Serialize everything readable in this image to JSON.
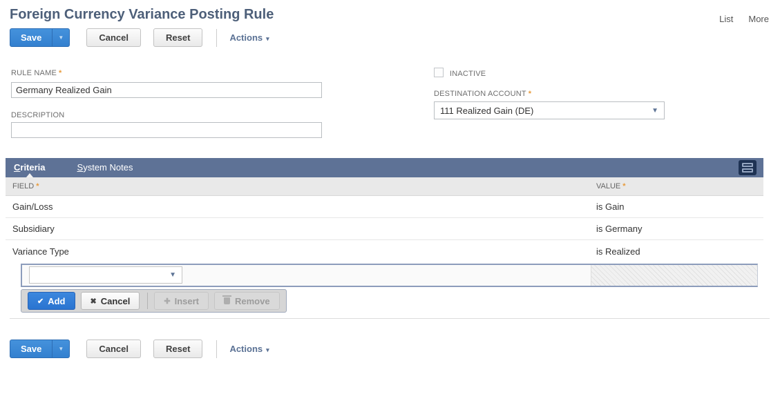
{
  "required_marker": "*",
  "icons": {
    "dropdown_arrow": "▼",
    "menu_arrow": "▾",
    "check": "✔",
    "x_mark": "✖",
    "plus": "✚"
  },
  "header": {
    "title": "Foreign Currency Variance Posting Rule",
    "links": {
      "list": "List",
      "more": "More"
    }
  },
  "toolbar": {
    "save": "Save",
    "cancel": "Cancel",
    "reset": "Reset",
    "actions": "Actions"
  },
  "form": {
    "rule_name": {
      "label": "RULE NAME",
      "value": "Germany Realized Gain"
    },
    "description": {
      "label": "DESCRIPTION",
      "value": ""
    },
    "inactive": {
      "label": "INACTIVE",
      "checked": false
    },
    "destination_account": {
      "label": "DESTINATION ACCOUNT",
      "value": "111 Realized Gain (DE)"
    }
  },
  "tabs": {
    "criteria": {
      "first": "C",
      "rest": "riteria"
    },
    "system_notes": {
      "first": "S",
      "rest": "ystem Notes"
    }
  },
  "criteria": {
    "columns": {
      "field": "FIELD",
      "value": "VALUE"
    },
    "rows": [
      {
        "field": "Gain/Loss",
        "value": "is Gain"
      },
      {
        "field": "Subsidiary",
        "value": "is Germany"
      },
      {
        "field": "Variance Type",
        "value": "is Realized"
      }
    ],
    "new_row": {
      "field_value": ""
    },
    "buttons": {
      "add": "Add",
      "cancel": "Cancel",
      "insert": "Insert",
      "remove": "Remove"
    }
  },
  "colors": {
    "primary_blue": "#3b86d8",
    "tab_bar": "#5e7296",
    "required_orange": "#e89b3c",
    "title_text": "#4d5f79"
  }
}
